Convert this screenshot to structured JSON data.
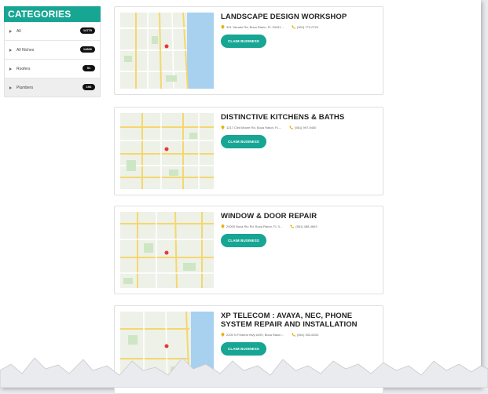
{
  "sidebar": {
    "header": "CATEGORIES",
    "items": [
      {
        "label": "All",
        "count": "14770"
      },
      {
        "label": "All Niches",
        "count": "14666"
      },
      {
        "label": "Roofers",
        "count": "51"
      },
      {
        "label": "Plumbers",
        "count": "106"
      }
    ]
  },
  "listings": [
    {
      "title": "LANDSCAPE DESIGN WORKSHOP",
      "address": "301 Yamato Rd, Boca Raton, FL 33431...",
      "phone": "(954) 772-0724",
      "button": "CLAIM BUSINESS"
    },
    {
      "title": "DISTINCTIVE KITCHENS & BATHS",
      "address": "1217 Clint Moore Rd, Boca Raton, FL...",
      "phone": "(561) 997-9400",
      "button": "CLAIM BUSINESS"
    },
    {
      "title": "WINDOW & DOOR REPAIR",
      "address": "20000 Boca Rio Rd, Boca Raton, FL 3...",
      "phone": "(561) 488-4663",
      "button": "CLAIM BUSINESS"
    },
    {
      "title": "XP TELECOM : AVAYA, NEC, PHONE SYSTEM REPAIR AND INSTALLATION",
      "address": "2200 N Federal Hwy #209, Boca Raton...",
      "phone": "(561) 392-6033",
      "button": "CLAIM BUSINESS"
    }
  ],
  "colors": {
    "accent": "#17a594",
    "badge": "#111111",
    "map_pin": "#e53935",
    "water": "#a8d1f0"
  },
  "icons": {
    "address": "map-pin-icon",
    "phone": "phone-icon",
    "category": "caret-right-icon"
  }
}
